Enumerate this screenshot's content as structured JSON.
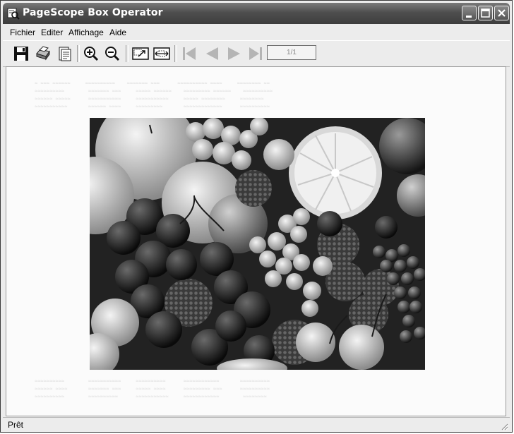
{
  "window": {
    "title": "PageScope Box Operator"
  },
  "menu": {
    "items": [
      "Fichier",
      "Editer",
      "Affichage",
      "Aide"
    ]
  },
  "toolbar": {
    "buttons": [
      "save-icon",
      "print-icon",
      "document-properties-icon",
      "zoom-in-icon",
      "zoom-out-icon",
      "fit-page-icon",
      "fit-width-icon",
      "first-page-icon",
      "previous-page-icon",
      "next-page-icon",
      "last-page-icon"
    ],
    "page_indicator": "1/1"
  },
  "status": {
    "text": "Prêt"
  },
  "colors": {
    "titlebar": "#4e4e4e",
    "chrome": "#ececec",
    "canvas": "#fbfbfb"
  }
}
